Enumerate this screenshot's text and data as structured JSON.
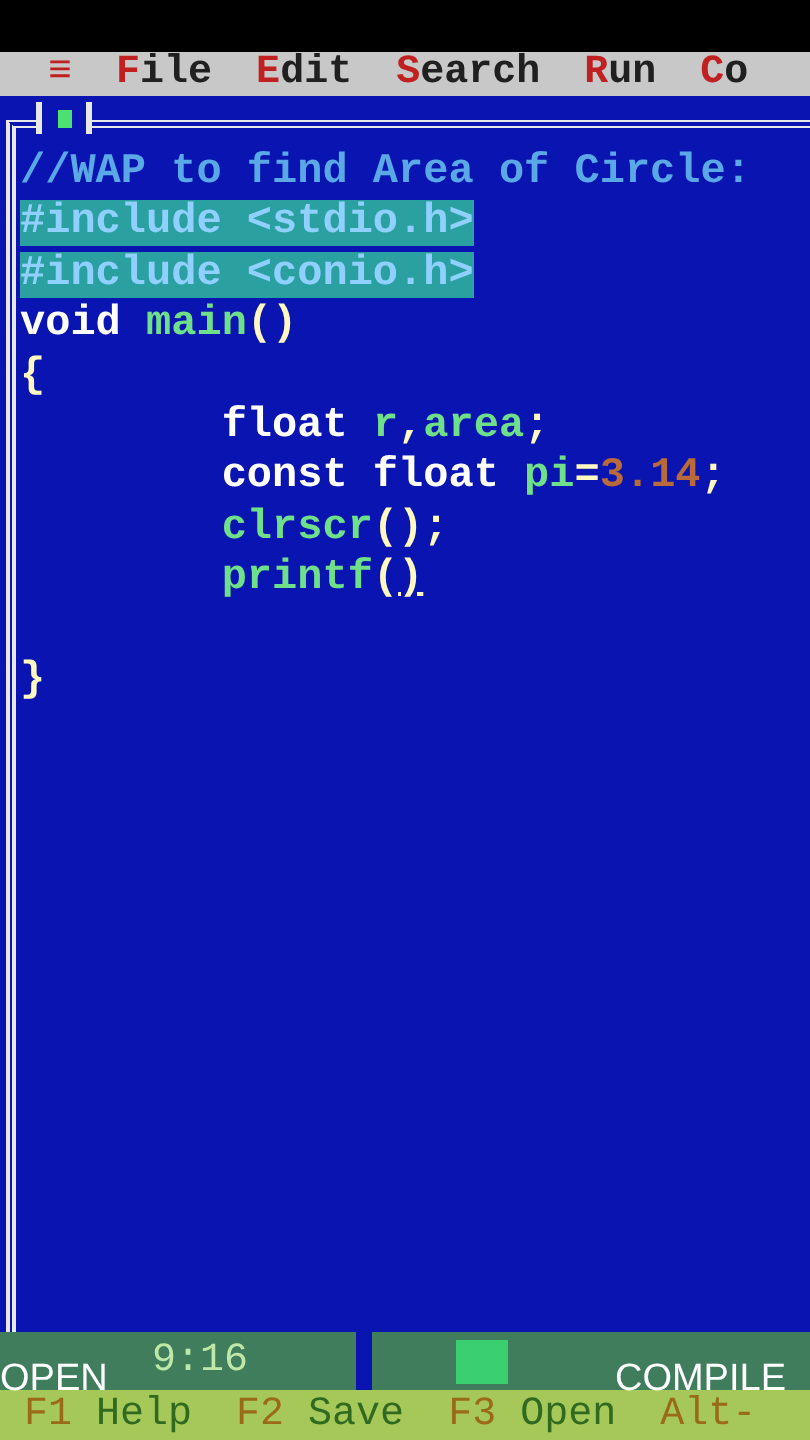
{
  "menu": [
    {
      "hotkey": "≡"
    },
    {
      "hotkey": "F",
      "rest": "ile"
    },
    {
      "hotkey": "E",
      "rest": "dit"
    },
    {
      "hotkey": "S",
      "rest": "earch"
    },
    {
      "hotkey": "R",
      "rest": "un"
    },
    {
      "hotkey": "C",
      "rest": "o"
    }
  ],
  "editor": {
    "lines": [
      {
        "selected": false,
        "segments": [
          {
            "kind": "comment",
            "text": "//WAP to find Area of Circle:"
          }
        ]
      },
      {
        "selected": true,
        "segments": [
          {
            "kind": "directive",
            "text": "#include <stdio.h>"
          }
        ]
      },
      {
        "selected": true,
        "segments": [
          {
            "kind": "directive",
            "text": "#include <conio.h>"
          }
        ]
      },
      {
        "selected": false,
        "segments": [
          {
            "kind": "keyword",
            "text": "void "
          },
          {
            "kind": "identifier",
            "text": "main"
          },
          {
            "kind": "symbol",
            "text": "()"
          }
        ]
      },
      {
        "selected": false,
        "segments": [
          {
            "kind": "symbol",
            "text": "{"
          }
        ]
      },
      {
        "selected": false,
        "segments": [
          {
            "kind": "keyword",
            "text": "        float "
          },
          {
            "kind": "identifier",
            "text": "r"
          },
          {
            "kind": "symbol",
            "text": ","
          },
          {
            "kind": "identifier",
            "text": "area"
          },
          {
            "kind": "symbol",
            "text": ";"
          }
        ]
      },
      {
        "selected": false,
        "segments": [
          {
            "kind": "keyword",
            "text": "        const float "
          },
          {
            "kind": "identifier",
            "text": "pi"
          },
          {
            "kind": "symbol",
            "text": "="
          },
          {
            "kind": "number",
            "text": "3.14"
          },
          {
            "kind": "symbol",
            "text": ";"
          }
        ]
      },
      {
        "selected": false,
        "segments": [
          {
            "kind": "identifier",
            "text": "        clrscr"
          },
          {
            "kind": "symbol",
            "text": "();"
          }
        ]
      },
      {
        "selected": false,
        "segments": [
          {
            "kind": "identifier",
            "text": "        printf"
          },
          {
            "kind": "symbol",
            "text": "("
          },
          {
            "kind": "cursor",
            "text": ")"
          }
        ]
      },
      {
        "selected": false
      },
      {
        "selected": false,
        "segments": [
          {
            "kind": "symbol",
            "text": "}"
          }
        ]
      }
    ],
    "position": "9:16"
  },
  "overlay_buttons": [
    {
      "label": "OPEN"
    },
    {
      "label": "COMPILE"
    }
  ],
  "status_bar": [
    {
      "key": "F1",
      "action": "Help"
    },
    {
      "key": "F2",
      "action": "Save"
    },
    {
      "key": "F3",
      "action": "Open"
    },
    {
      "key": "Alt-"
    }
  ]
}
